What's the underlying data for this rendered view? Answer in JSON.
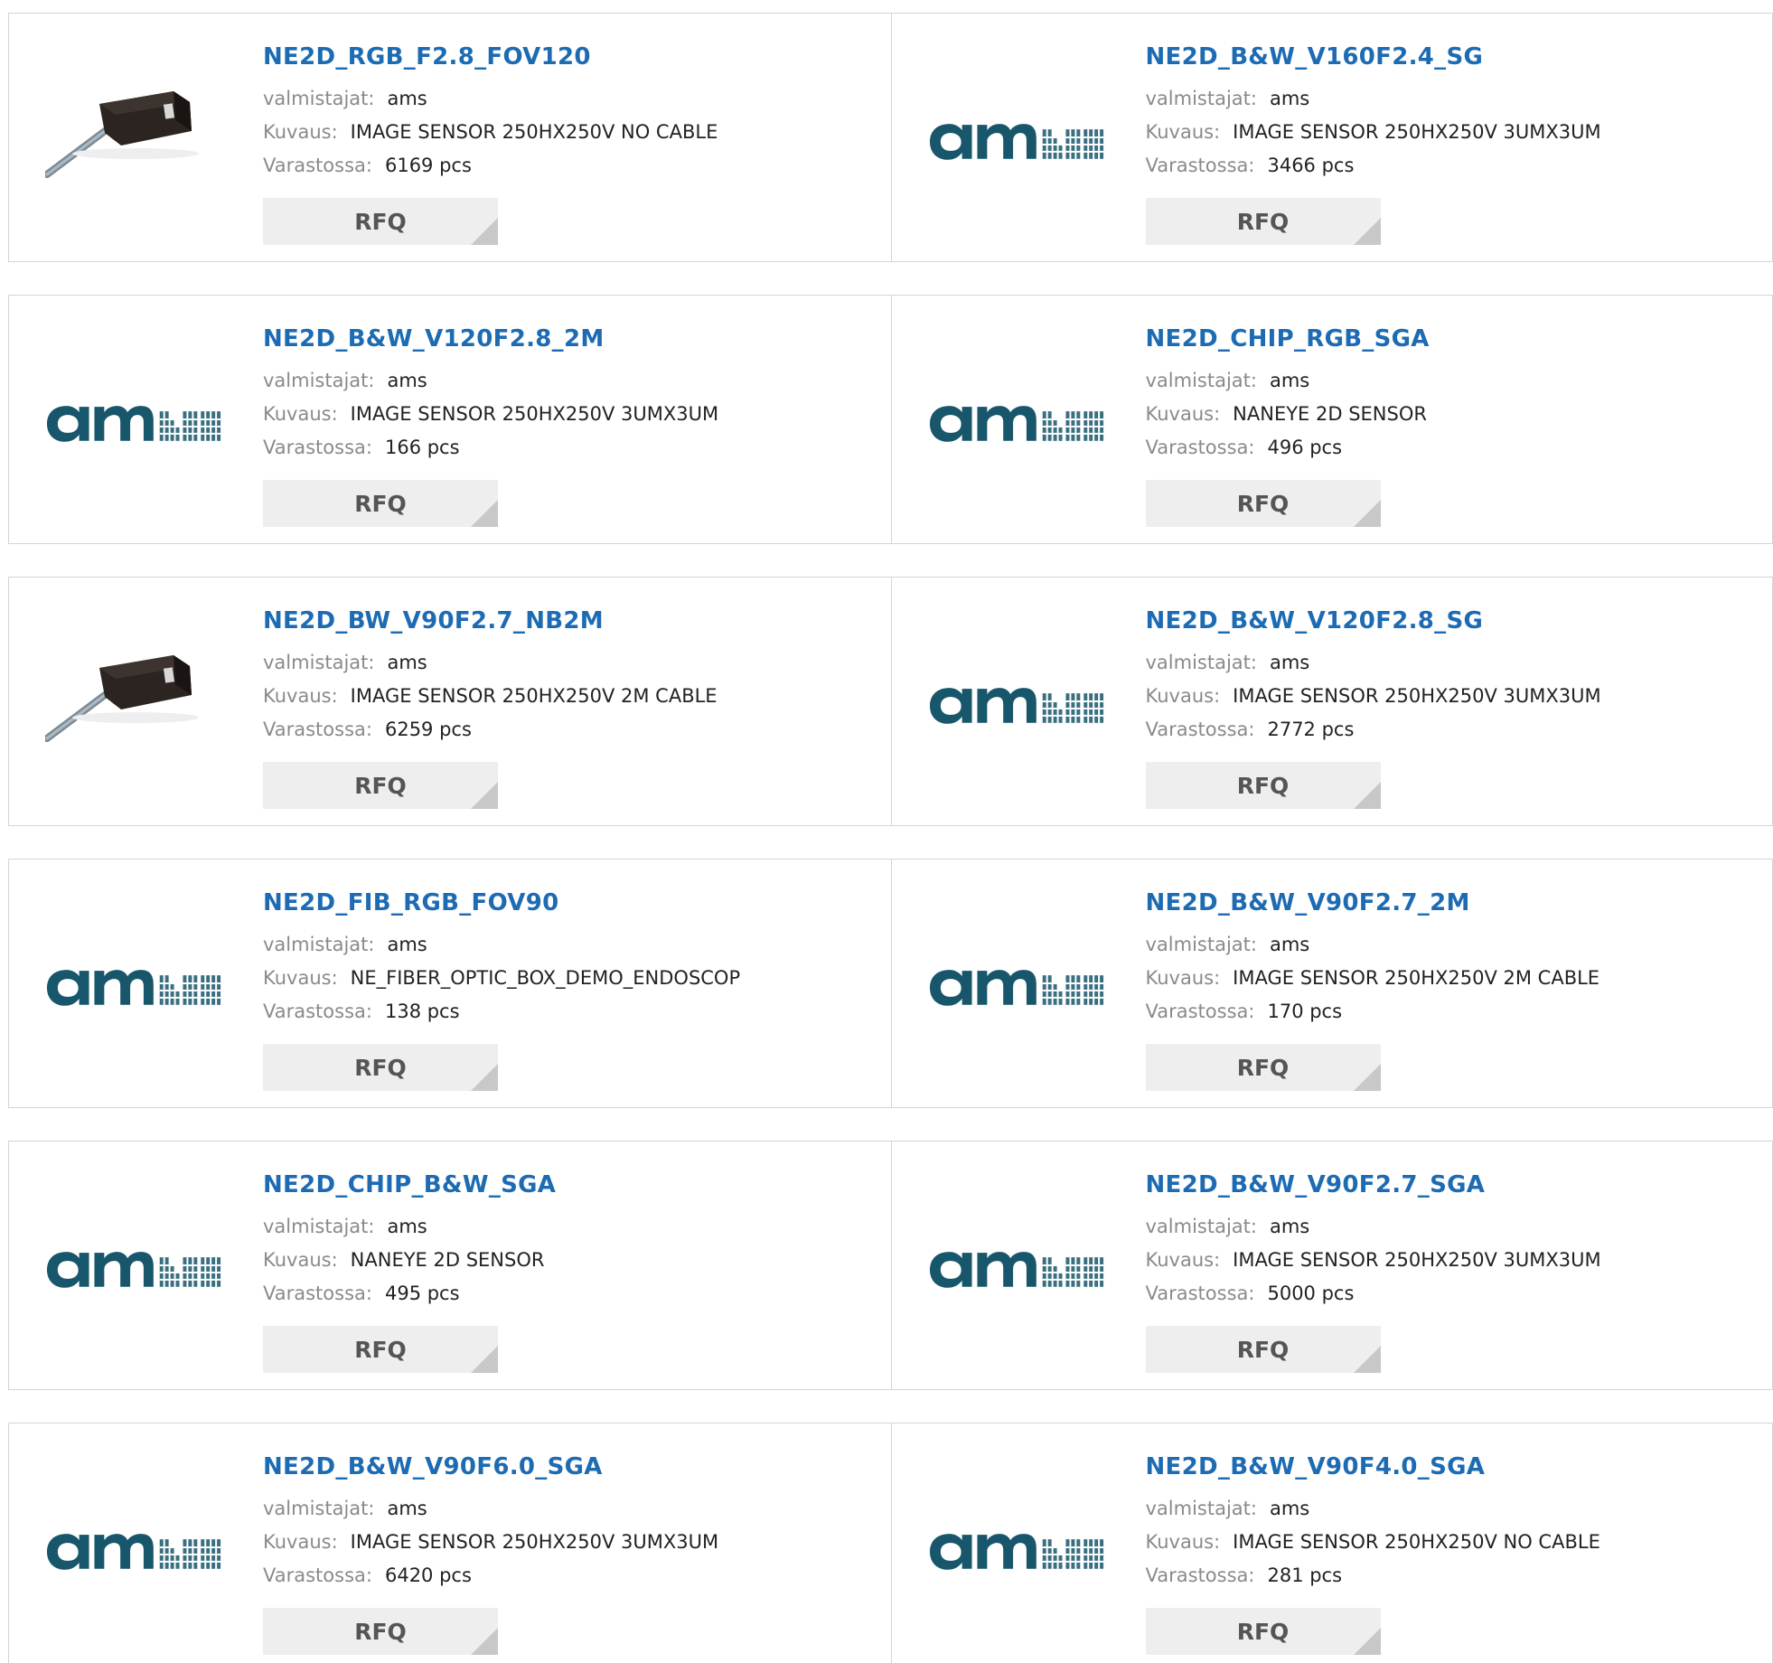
{
  "labels": {
    "manufacturer": "valmistajat:",
    "description": "Kuvaus:",
    "stock": "Varastossa:",
    "rfq": "RFQ"
  },
  "colors": {
    "link": "#1d6bb3",
    "logo": "#17566b",
    "rfq_bg": "#eeeeee",
    "border": "#d4d4d4"
  },
  "rows": [
    {
      "products": [
        {
          "part": "NE2D_RGB_F2.8_FOV120",
          "manufacturer": "ams",
          "description": "IMAGE SENSOR 250HX250V NO CABLE",
          "stock": "6169 pcs",
          "image": "camera-photo"
        },
        {
          "part": "NE2D_B&W_V160F2.4_SG",
          "manufacturer": "ams",
          "description": "IMAGE SENSOR 250HX250V 3UMX3UM",
          "stock": "3466 pcs",
          "image": "ams-logo"
        }
      ]
    },
    {
      "products": [
        {
          "part": "NE2D_B&W_V120F2.8_2M",
          "manufacturer": "ams",
          "description": "IMAGE SENSOR 250HX250V 3UMX3UM",
          "stock": "166 pcs",
          "image": "ams-logo"
        },
        {
          "part": "NE2D_CHIP_RGB_SGA",
          "manufacturer": "ams",
          "description": "NANEYE 2D SENSOR",
          "stock": "496 pcs",
          "image": "ams-logo"
        }
      ]
    },
    {
      "products": [
        {
          "part": "NE2D_BW_V90F2.7_NB2M",
          "manufacturer": "ams",
          "description": "IMAGE SENSOR 250HX250V 2M CABLE",
          "stock": "6259 pcs",
          "image": "camera-photo"
        },
        {
          "part": "NE2D_B&W_V120F2.8_SG",
          "manufacturer": "ams",
          "description": "IMAGE SENSOR 250HX250V 3UMX3UM",
          "stock": "2772 pcs",
          "image": "ams-logo"
        }
      ]
    },
    {
      "products": [
        {
          "part": "NE2D_FIB_RGB_FOV90",
          "manufacturer": "ams",
          "description": "NE_FIBER_OPTIC_BOX_DEMO_ENDOSCOP",
          "stock": "138 pcs",
          "image": "ams-logo"
        },
        {
          "part": "NE2D_B&W_V90F2.7_2M",
          "manufacturer": "ams",
          "description": "IMAGE SENSOR 250HX250V 2M CABLE",
          "stock": "170 pcs",
          "image": "ams-logo"
        }
      ]
    },
    {
      "products": [
        {
          "part": "NE2D_CHIP_B&W_SGA",
          "manufacturer": "ams",
          "description": "NANEYE 2D SENSOR",
          "stock": "495 pcs",
          "image": "ams-logo"
        },
        {
          "part": "NE2D_B&W_V90F2.7_SGA",
          "manufacturer": "ams",
          "description": "IMAGE SENSOR 250HX250V 3UMX3UM",
          "stock": "5000 pcs",
          "image": "ams-logo"
        }
      ]
    },
    {
      "products": [
        {
          "part": "NE2D_B&W_V90F6.0_SGA",
          "manufacturer": "ams",
          "description": "IMAGE SENSOR 250HX250V 3UMX3UM",
          "stock": "6420 pcs",
          "image": "ams-logo"
        },
        {
          "part": "NE2D_B&W_V90F4.0_SGA",
          "manufacturer": "ams",
          "description": "IMAGE SENSOR 250HX250V NO CABLE",
          "stock": "281 pcs",
          "image": "ams-logo"
        }
      ]
    }
  ]
}
